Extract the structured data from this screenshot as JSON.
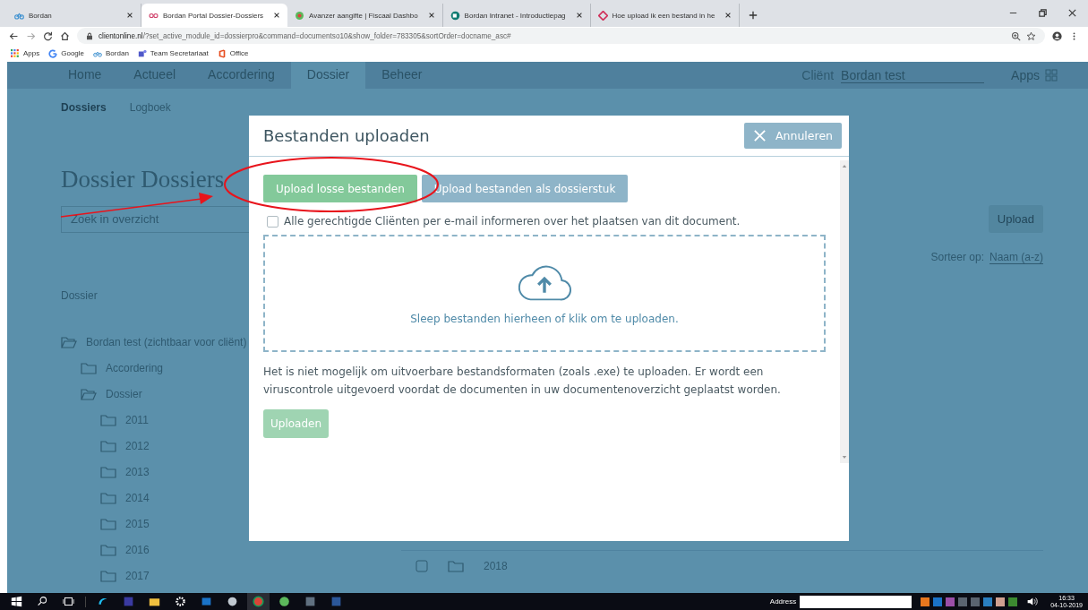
{
  "browser": {
    "tabs": [
      {
        "title": "Bordan",
        "selected": false
      },
      {
        "title": "Bordan Portal Dossier-Dossiers",
        "selected": true
      },
      {
        "title": "Avanzer aangifte | Fiscaal Dashbo",
        "selected": false
      },
      {
        "title": "Bordan Intranet - Introductiepag",
        "selected": false
      },
      {
        "title": "Hoe upload ik een bestand in he",
        "selected": false
      }
    ],
    "url_host": "clientonline.nl",
    "url_path": "/?set_active_module_id=dossierpro&command=documentso10&show_folder=783305&sortOrder=docname_asc#",
    "bookmarks": [
      {
        "label": "Apps"
      },
      {
        "label": "Google"
      },
      {
        "label": "Bordan"
      },
      {
        "label": "Team Secretariaat"
      },
      {
        "label": "Office"
      }
    ]
  },
  "page": {
    "nav": [
      {
        "label": "Home",
        "selected": false
      },
      {
        "label": "Actueel",
        "selected": false
      },
      {
        "label": "Accordering",
        "selected": false
      },
      {
        "label": "Dossier",
        "selected": true
      },
      {
        "label": "Beheer",
        "selected": false
      }
    ],
    "client_label": "Cliënt",
    "client_value": "Bordan test",
    "apps_label": "Apps",
    "subnav": [
      {
        "label": "Dossiers",
        "selected": true
      },
      {
        "label": "Logboek",
        "selected": false
      }
    ],
    "title": "Dossier Dossiers",
    "search_placeholder": "Zoek in overzicht",
    "upload_button": "Upload",
    "sort_label": "Sorteer op:",
    "sort_value": "Naam (a-z)",
    "tree_heading": "Dossier",
    "tree": [
      {
        "label": "Bordan test (zichtbaar voor cliënt)",
        "expanded": true,
        "children": [
          {
            "label": "Accordering",
            "expanded": false
          },
          {
            "label": "Dossier",
            "expanded": true,
            "children": [
              {
                "label": "2011",
                "expanded": false
              },
              {
                "label": "2012",
                "expanded": false
              },
              {
                "label": "2013",
                "expanded": false
              },
              {
                "label": "2014",
                "expanded": false
              },
              {
                "label": "2015",
                "expanded": false
              },
              {
                "label": "2016",
                "expanded": false
              },
              {
                "label": "2017",
                "expanded": false
              }
            ]
          }
        ]
      }
    ],
    "table_rows": [
      {
        "name": "2018",
        "checked": false
      }
    ]
  },
  "dialog": {
    "title": "Bestanden uploaden",
    "cancel": "Annuleren",
    "mode_buttons": [
      {
        "label": "Upload losse bestanden",
        "selected": true
      },
      {
        "label": "Upload bestanden als dossierstuk",
        "selected": false
      }
    ],
    "notify": {
      "label": "Alle gerechtigde Cliënten per e-mail informeren over het plaatsen van dit document.",
      "checked": false
    },
    "dropzone": "Sleep bestanden hierheen of klik om te uploaden.",
    "note": "Het is niet mogelijk om uitvoerbare bestandsformaten (zoals .exe) te uploaden. Er wordt een viruscontrole uitgevoerd voordat de documenten in uw documentenoverzicht geplaatst worden.",
    "submit": {
      "label": "Uploaden",
      "disabled": true
    }
  },
  "taskbar": {
    "address_label": "Address",
    "time": "16:33",
    "date": "04-10-2019"
  }
}
